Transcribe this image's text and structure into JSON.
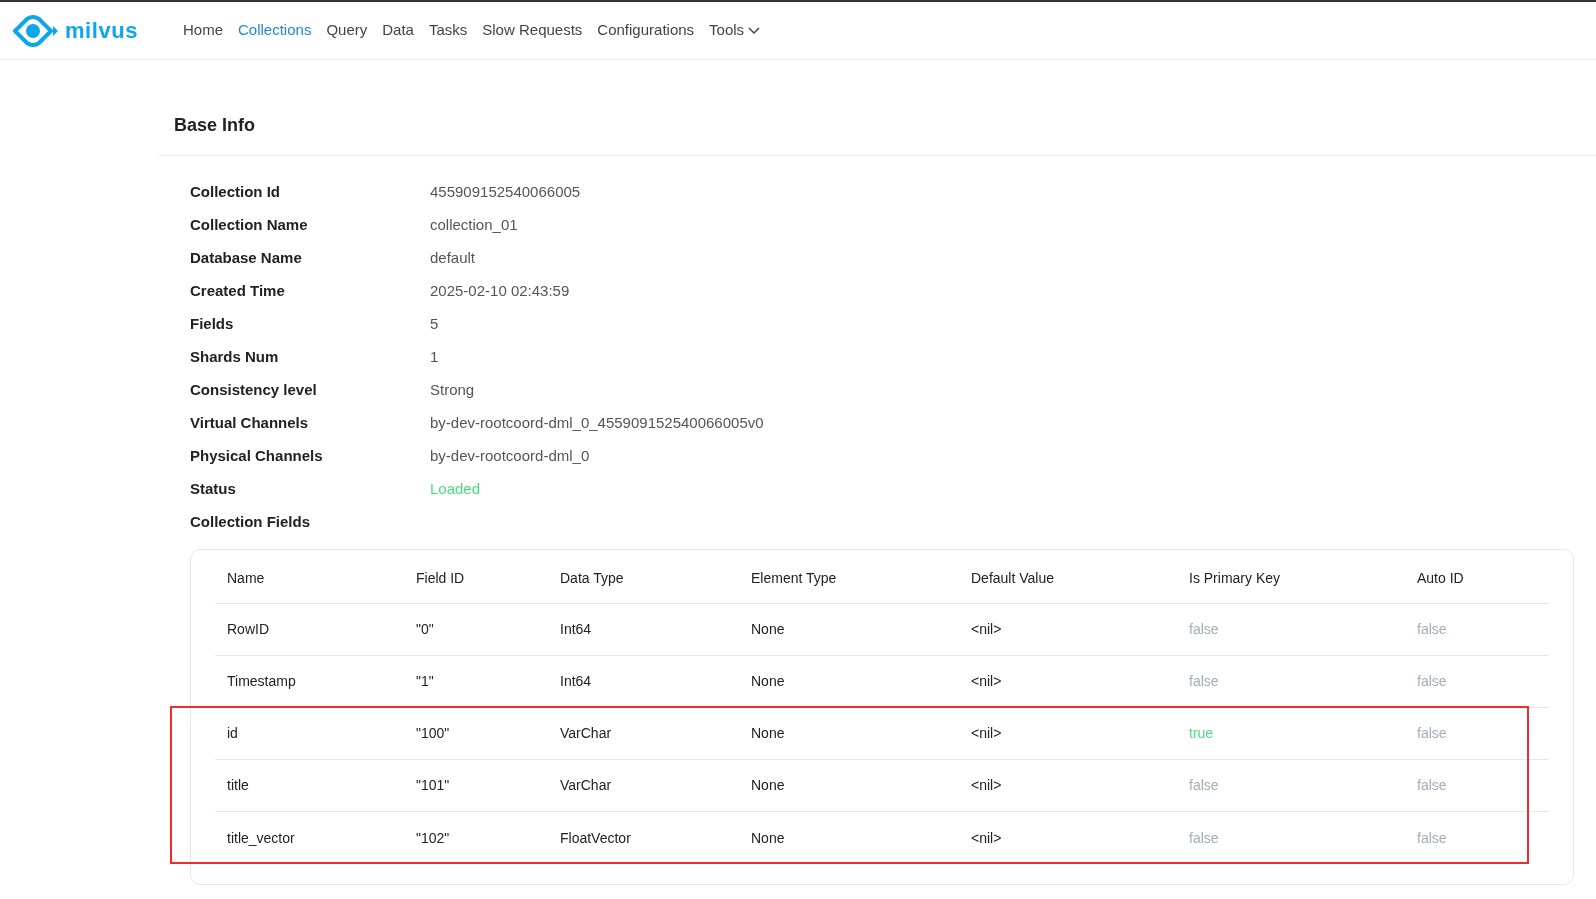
{
  "brand": {
    "name": "milvus"
  },
  "nav": [
    {
      "label": "Home",
      "selected": false,
      "dropdown": false
    },
    {
      "label": "Collections",
      "selected": true,
      "dropdown": false
    },
    {
      "label": "Query",
      "selected": false,
      "dropdown": false
    },
    {
      "label": "Data",
      "selected": false,
      "dropdown": false
    },
    {
      "label": "Tasks",
      "selected": false,
      "dropdown": false
    },
    {
      "label": "Slow Requests",
      "selected": false,
      "dropdown": false
    },
    {
      "label": "Configurations",
      "selected": false,
      "dropdown": false
    },
    {
      "label": "Tools",
      "selected": false,
      "dropdown": true
    }
  ],
  "section_title": "Base Info",
  "info": [
    {
      "label": "Collection Id",
      "value": "455909152540066005",
      "kind": "text"
    },
    {
      "label": "Collection Name",
      "value": "collection_01",
      "kind": "text"
    },
    {
      "label": "Database Name",
      "value": "default",
      "kind": "text"
    },
    {
      "label": "Created Time",
      "value": "2025-02-10 02:43:59",
      "kind": "text"
    },
    {
      "label": "Fields",
      "value": "5",
      "kind": "text"
    },
    {
      "label": "Shards Num",
      "value": "1",
      "kind": "text"
    },
    {
      "label": "Consistency level",
      "value": "Strong",
      "kind": "text"
    },
    {
      "label": "Virtual Channels",
      "value": "by-dev-rootcoord-dml_0_455909152540066005v0",
      "kind": "text"
    },
    {
      "label": "Physical Channels",
      "value": "by-dev-rootcoord-dml_0",
      "kind": "text"
    },
    {
      "label": "Status",
      "value": "Loaded",
      "kind": "status"
    },
    {
      "label": "Collection Fields",
      "kind": "heading"
    }
  ],
  "table": {
    "columns": [
      "Name",
      "Field ID",
      "Data Type",
      "Element Type",
      "Default Value",
      "Is Primary Key",
      "Auto ID"
    ],
    "rows": [
      {
        "cells": [
          "RowID",
          "\"0\"",
          "Int64",
          "None",
          "<nil>"
        ],
        "is_primary_key": {
          "text": "false",
          "on": false
        },
        "auto_id": {
          "text": "false",
          "on": false
        },
        "marked": false
      },
      {
        "cells": [
          "Timestamp",
          "\"1\"",
          "Int64",
          "None",
          "<nil>"
        ],
        "is_primary_key": {
          "text": "false",
          "on": false
        },
        "auto_id": {
          "text": "false",
          "on": false
        },
        "marked": false
      },
      {
        "cells": [
          "id",
          "\"100\"",
          "VarChar",
          "None",
          "<nil>"
        ],
        "is_primary_key": {
          "text": "true",
          "on": true
        },
        "auto_id": {
          "text": "false",
          "on": false
        },
        "marked": true
      },
      {
        "cells": [
          "title",
          "\"101\"",
          "VarChar",
          "None",
          "<nil>"
        ],
        "is_primary_key": {
          "text": "false",
          "on": false
        },
        "auto_id": {
          "text": "false",
          "on": false
        },
        "marked": true
      },
      {
        "cells": [
          "title_vector",
          "\"102\"",
          "FloatVector",
          "None",
          "<nil>"
        ],
        "is_primary_key": {
          "text": "false",
          "on": false
        },
        "auto_id": {
          "text": "false",
          "on": false
        },
        "marked": true
      }
    ]
  }
}
